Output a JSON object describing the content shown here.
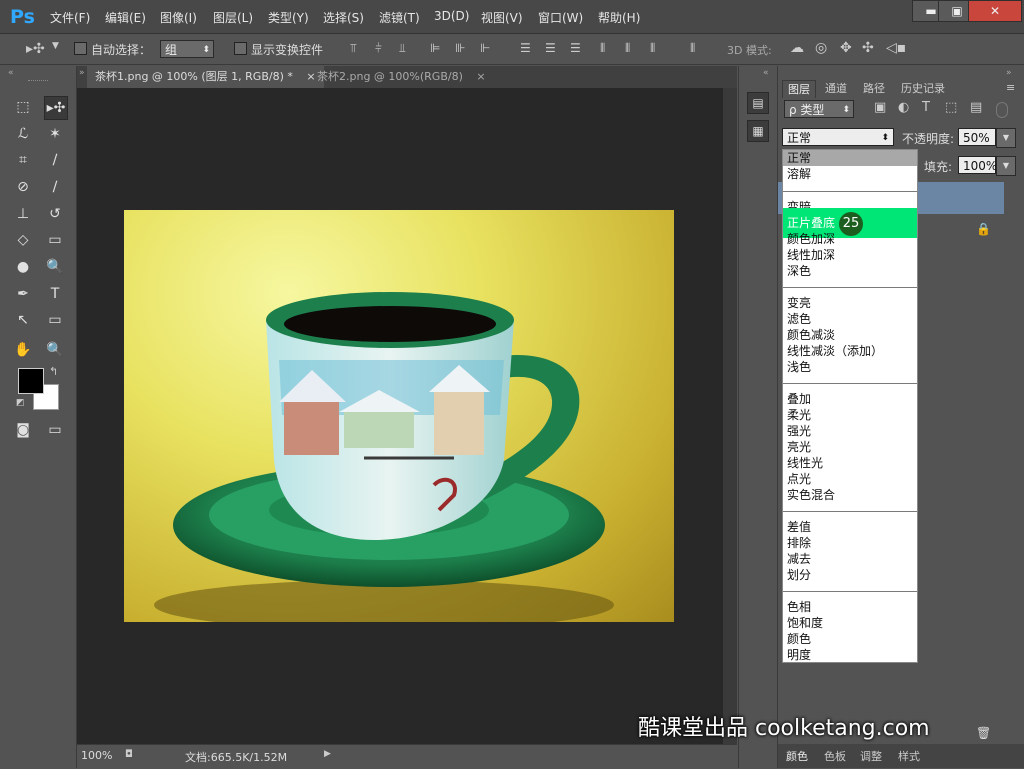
{
  "app": {
    "logo": "Ps"
  },
  "menu": [
    "文件(F)",
    "编辑(E)",
    "图像(I)",
    "图层(L)",
    "类型(Y)",
    "选择(S)",
    "滤镜(T)",
    "3D(D)",
    "视图(V)",
    "窗口(W)",
    "帮助(H)"
  ],
  "window_controls": {
    "min": "▬",
    "max": "▣",
    "close": "✕"
  },
  "options_bar": {
    "auto_select_label": "自动选择：",
    "auto_select_value": "组",
    "show_transform_label": "显示变换控件",
    "mode_3d_label": "3D 模式:"
  },
  "tabs": [
    {
      "label": "茶杯1.png @ 100% (图层 1, RGB/8) *",
      "close": "×"
    },
    {
      "label": "茶杯2.png @ 100%(RGB/8)",
      "close": "×"
    }
  ],
  "status": {
    "zoom": "100%",
    "doc": "文档:665.5K/1.52M"
  },
  "layers_panel": {
    "tabs": [
      "图层",
      "通道",
      "路径",
      "历史记录"
    ],
    "filter_label": "ρ 类型",
    "blend_value": "正常",
    "opacity_label": "不透明度:",
    "opacity_value": "50%",
    "fill_label": "填充:",
    "fill_value": "100%"
  },
  "blend_modes": {
    "groups": [
      [
        "正常",
        "溶解"
      ],
      [
        "变暗",
        "正片叠底",
        "颜色加深",
        "线性加深",
        "深色"
      ],
      [
        "变亮",
        "滤色",
        "颜色减淡",
        "线性减淡（添加）",
        "浅色"
      ],
      [
        "叠加",
        "柔光",
        "强光",
        "亮光",
        "线性光",
        "点光",
        "实色混合"
      ],
      [
        "差值",
        "排除",
        "减去",
        "划分"
      ],
      [
        "色相",
        "饱和度",
        "颜色",
        "明度"
      ]
    ],
    "highlighted": "正片叠底",
    "step_badge": "25"
  },
  "bottom_tabs": [
    "颜色",
    "色板",
    "调整",
    "样式"
  ],
  "watermark": "酷课堂出品 coolketang.com",
  "colors": {
    "highlight": "#00e676",
    "badge": "#1b5e20",
    "ps_blue": "#31a8ff"
  }
}
